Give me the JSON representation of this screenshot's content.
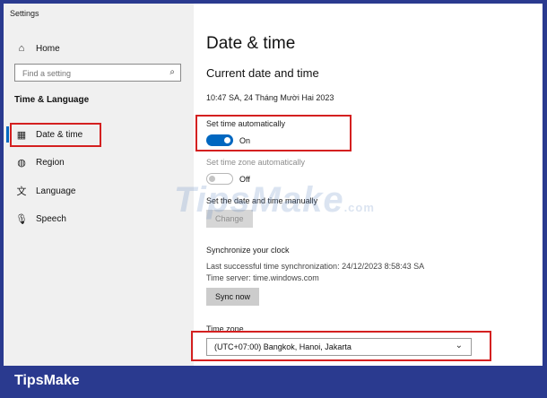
{
  "window": {
    "title": "Settings"
  },
  "sidebar": {
    "home_label": "Home",
    "search_placeholder": "Find a setting",
    "section_title": "Time & Language",
    "items": [
      {
        "label": "Date & time",
        "icon": "calendar-clock-icon",
        "active": true
      },
      {
        "label": "Region",
        "icon": "globe-icon",
        "active": false
      },
      {
        "label": "Language",
        "icon": "language-icon",
        "active": false
      },
      {
        "label": "Speech",
        "icon": "microphone-icon",
        "active": false
      }
    ]
  },
  "main": {
    "title": "Date & time",
    "section_title": "Current date and time",
    "current_datetime": "10:47 SA, 24 Tháng Mười Hai 2023",
    "set_time_auto": {
      "label": "Set time automatically",
      "state": "On"
    },
    "set_timezone_auto": {
      "label": "Set time zone automatically",
      "state": "Off"
    },
    "manual": {
      "label": "Set the date and time manually",
      "button": "Change"
    },
    "sync": {
      "title": "Synchronize your clock",
      "last_sync": "Last successful time synchronization: 24/12/2023 8:58:43 SA",
      "server": "Time server: time.windows.com",
      "button": "Sync now"
    },
    "timezone": {
      "label": "Time zone",
      "value": "(UTC+07:00) Bangkok, Hanoi, Jakarta"
    }
  },
  "watermark": {
    "text": "TipsMake",
    "suffix": ".com"
  },
  "branding": {
    "footer": "TipsMake"
  },
  "colors": {
    "accent": "#0067c0",
    "highlight": "#d42020",
    "footer_bg": "#2a3a8f"
  }
}
